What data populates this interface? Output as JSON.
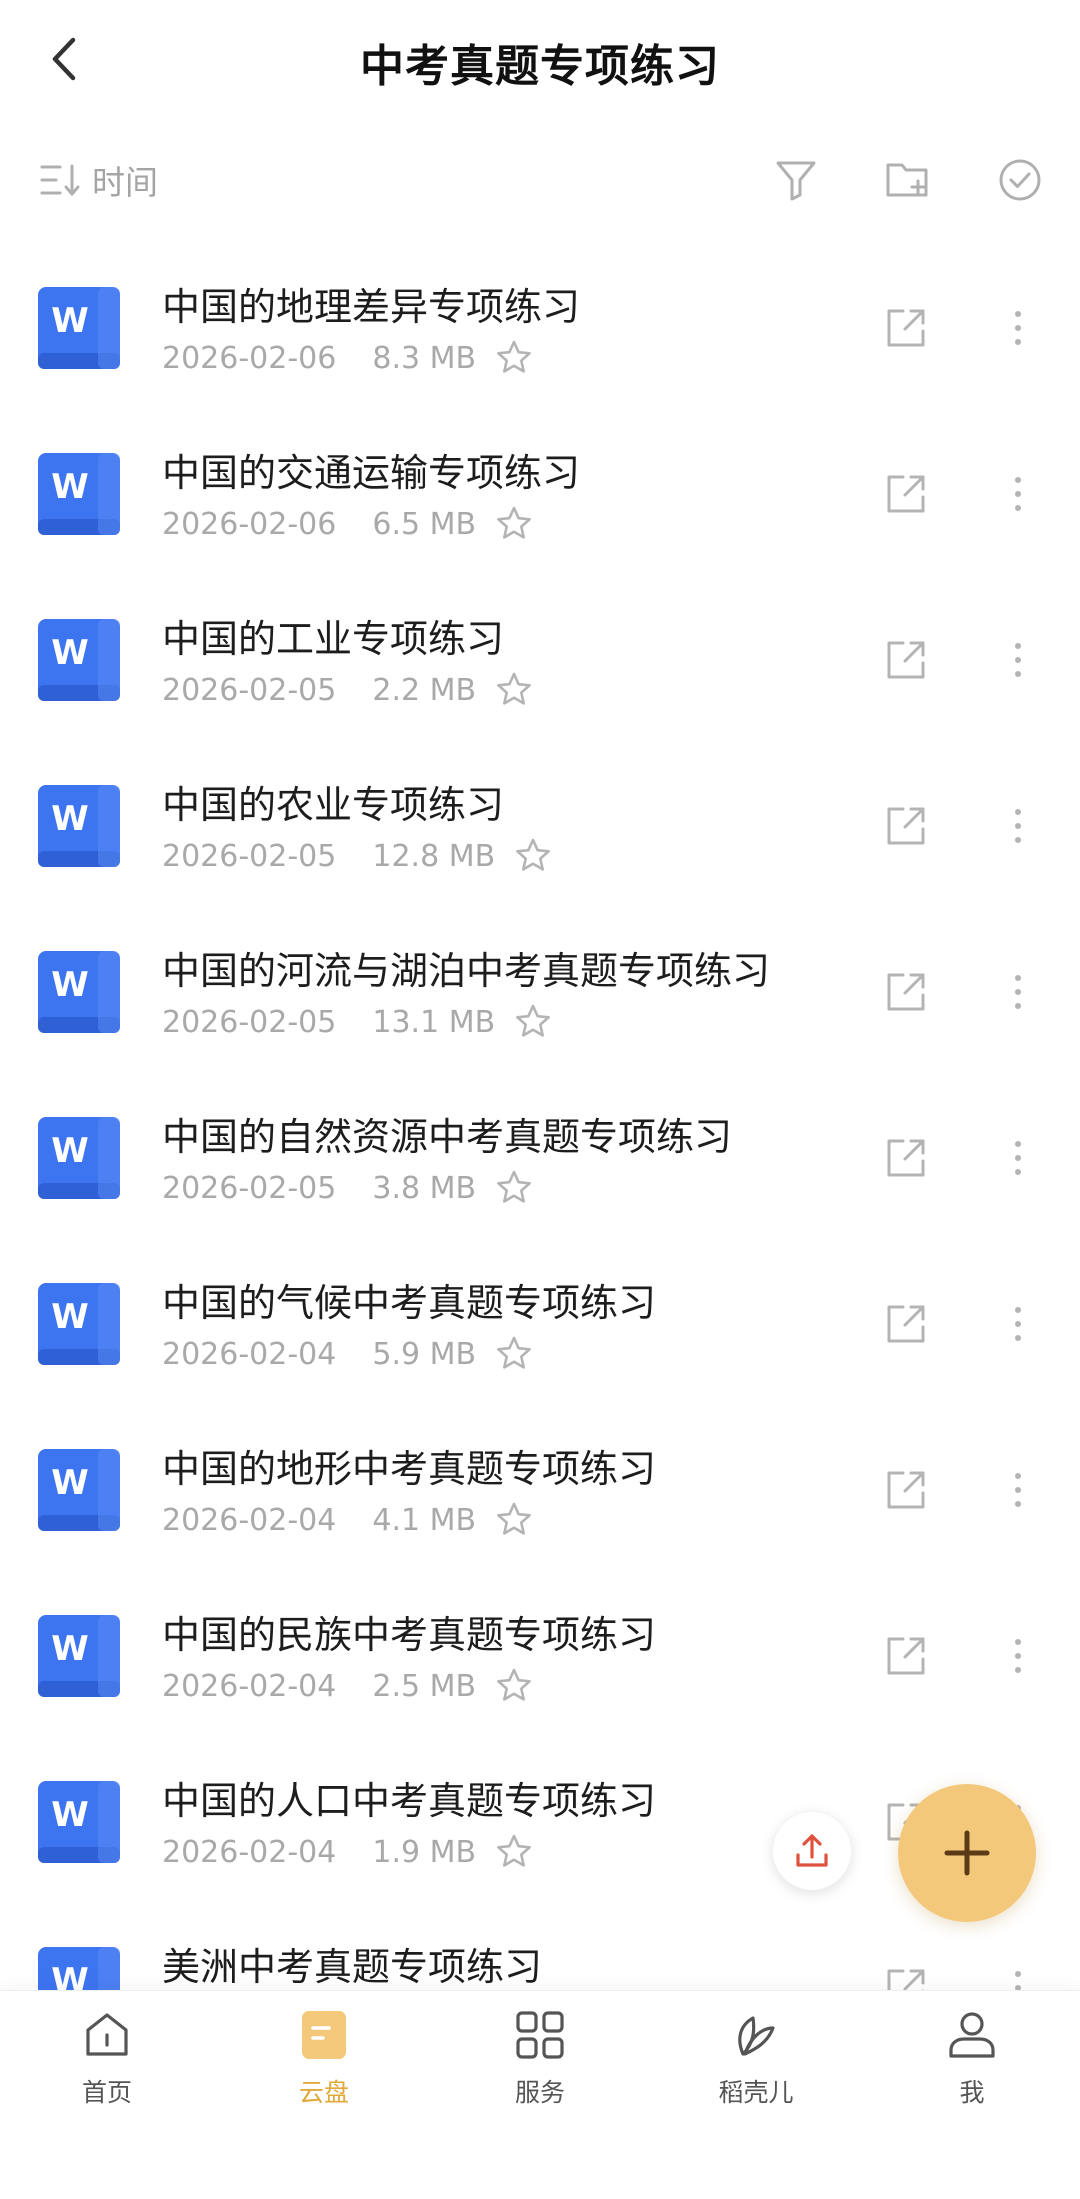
{
  "header": {
    "title": "中考真题专项练习"
  },
  "toolbar": {
    "sort_label": "时间"
  },
  "colors": {
    "word_blue": "#3d74f0",
    "accent": "#f3c87a",
    "active_nav": "#e0a93c",
    "upload_red": "#e0513e"
  },
  "files": [
    {
      "name": "中国的地理差异专项练习",
      "date": "2026-02-06",
      "size": "8.3 MB"
    },
    {
      "name": "中国的交通运输专项练习",
      "date": "2026-02-06",
      "size": "6.5 MB"
    },
    {
      "name": "中国的工业专项练习",
      "date": "2026-02-05",
      "size": "2.2 MB"
    },
    {
      "name": "中国的农业专项练习",
      "date": "2026-02-05",
      "size": "12.8 MB"
    },
    {
      "name": "中国的河流与湖泊中考真题专项练习",
      "date": "2026-02-05",
      "size": "13.1 MB"
    },
    {
      "name": "中国的自然资源中考真题专项练习",
      "date": "2026-02-05",
      "size": "3.8 MB"
    },
    {
      "name": "中国的气候中考真题专项练习",
      "date": "2026-02-04",
      "size": "5.9 MB"
    },
    {
      "name": "中国的地形中考真题专项练习",
      "date": "2026-02-04",
      "size": "4.1 MB"
    },
    {
      "name": "中国的民族中考真题专项练习",
      "date": "2026-02-04",
      "size": "2.5 MB"
    },
    {
      "name": "中国的人口中考真题专项练习",
      "date": "2026-02-04",
      "size": "1.9 MB"
    },
    {
      "name": "美洲中考真题专项练习",
      "date": "",
      "size": ""
    }
  ],
  "word_icon_letter": "W",
  "nav": {
    "items": [
      {
        "label": "首页",
        "icon": "home-icon",
        "active": false
      },
      {
        "label": "云盘",
        "icon": "cloud-drive-icon",
        "active": true
      },
      {
        "label": "服务",
        "icon": "grid-icon",
        "active": false
      },
      {
        "label": "稻壳儿",
        "icon": "leaf-icon",
        "active": false
      },
      {
        "label": "我",
        "icon": "user-icon",
        "active": false
      }
    ]
  }
}
